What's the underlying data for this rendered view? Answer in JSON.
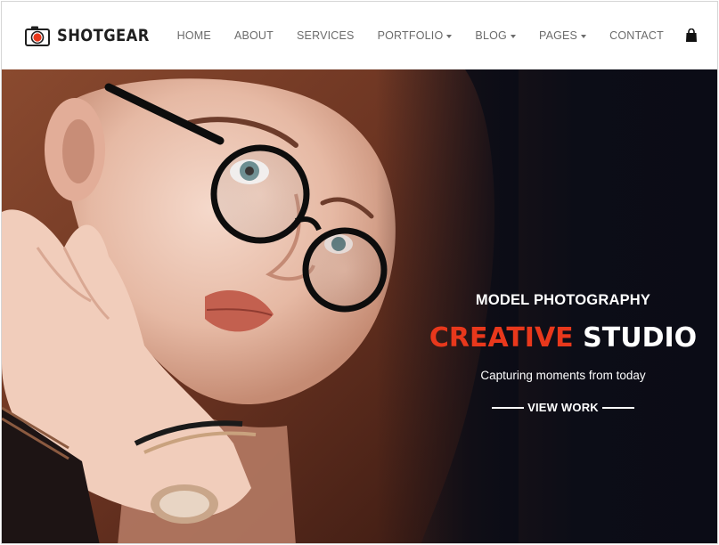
{
  "brand": {
    "name": "SHOTGEAR",
    "icon": "camera-icon",
    "accent_color": "#e8381c"
  },
  "nav": {
    "items": [
      {
        "label": "HOME",
        "dropdown": false
      },
      {
        "label": "ABOUT",
        "dropdown": false
      },
      {
        "label": "SERVICES",
        "dropdown": false
      },
      {
        "label": "PORTFOLIO",
        "dropdown": true
      },
      {
        "label": "BLOG",
        "dropdown": true
      },
      {
        "label": "PAGES",
        "dropdown": true
      },
      {
        "label": "CONTACT",
        "dropdown": false
      }
    ],
    "cart_icon": "shopping-bag-icon"
  },
  "hero": {
    "subtitle": "MODEL PHOTOGRAPHY",
    "headline_accent": "CREATIVE",
    "headline_rest": "STUDIO",
    "tagline": "Capturing moments from today",
    "cta_label": "VIEW WORK",
    "colors": {
      "accent": "#e8381c",
      "text": "#ffffff",
      "background_dark": "#0b0c16"
    }
  }
}
